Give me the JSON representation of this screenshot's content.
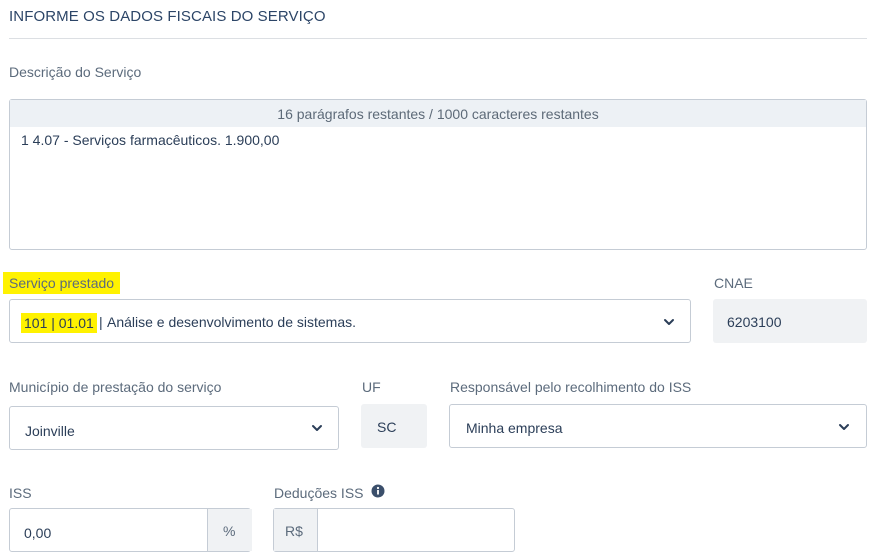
{
  "section_title": "INFORME OS DADOS FISCAIS DO SERVIÇO",
  "descricao": {
    "label": "Descrição do Serviço",
    "counter": "16 parágrafos restantes / 1000 caracteres restantes",
    "value": "1 4.07 - Serviços farmacêuticos. 1.900,00"
  },
  "servico": {
    "label": "Serviço prestado",
    "code": "101 | 01.01",
    "sep": "|",
    "description": "Análise e desenvolvimento de sistemas."
  },
  "cnae": {
    "label": "CNAE",
    "value": "6203100"
  },
  "municipio": {
    "label": "Município de prestação do serviço",
    "value": "Joinville"
  },
  "uf": {
    "label": "UF",
    "value": "SC"
  },
  "responsavel": {
    "label": "Responsável pelo recolhimento do ISS",
    "value": "Minha empresa"
  },
  "iss": {
    "label": "ISS",
    "value": "0,00",
    "suffix": "%"
  },
  "deducoes": {
    "label": "Deduções ISS",
    "prefix": "R$",
    "value": ""
  },
  "colors": {
    "highlight": "#fff200",
    "text": "#2b3e58",
    "border": "#c5ccd5"
  },
  "icons": [
    "chevron-down-icon",
    "info-icon"
  ]
}
